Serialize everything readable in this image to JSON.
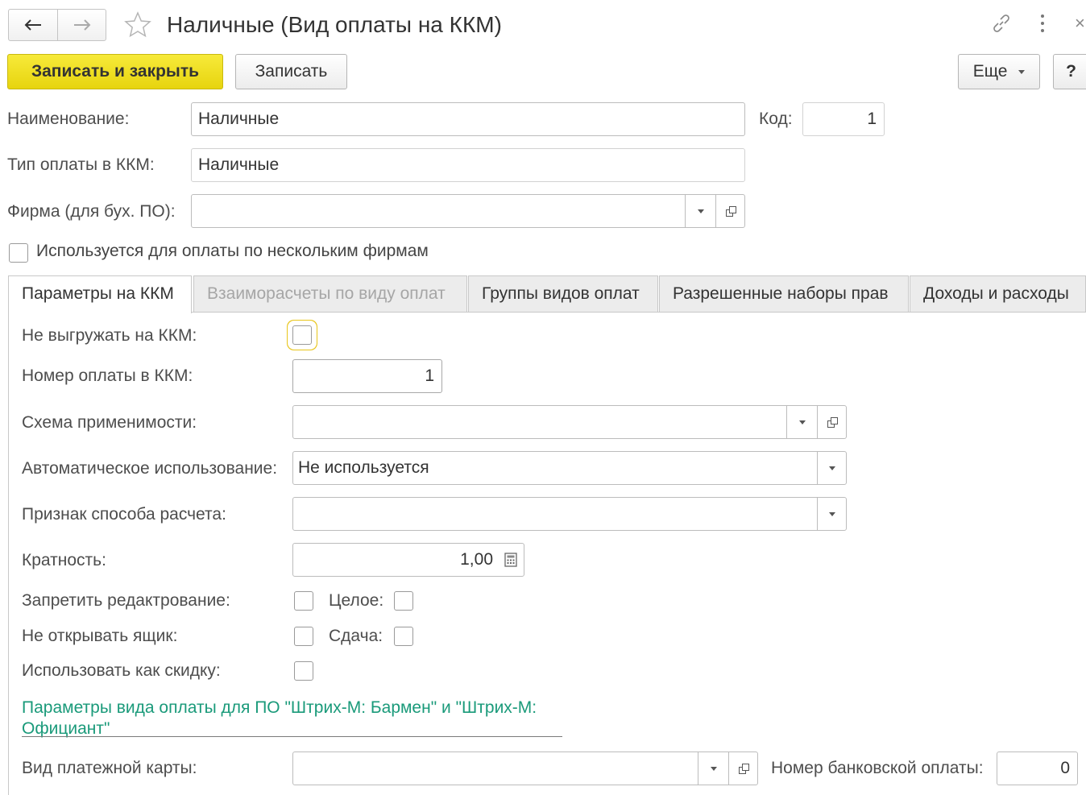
{
  "window": {
    "title": "Наличные (Вид оплаты на ККМ)"
  },
  "toolbar": {
    "save_close_label": "Записать и закрыть",
    "save_label": "Записать",
    "more_label": "Еще",
    "help_label": "?"
  },
  "header": {
    "name_label": "Наименование:",
    "name_value": "Наличные",
    "code_label": "Код:",
    "code_value": "1",
    "kkm_type_label": "Тип оплаты в ККМ:",
    "kkm_type_value": "Наличные",
    "firm_label": "Фирма (для бух. ПО):",
    "firm_value": "",
    "multi_firm_label": "Используется для оплаты по нескольким фирмам",
    "multi_firm_checked": false
  },
  "tabs": [
    {
      "label": "Параметры на ККМ",
      "active": true,
      "enabled": true
    },
    {
      "label": "Взаиморасчеты по виду оплат",
      "active": false,
      "enabled": false
    },
    {
      "label": "Группы видов оплат",
      "active": false,
      "enabled": true
    },
    {
      "label": "Разрешенные наборы прав",
      "active": false,
      "enabled": true
    },
    {
      "label": "Доходы и расходы",
      "active": false,
      "enabled": true
    }
  ],
  "params": {
    "no_export_label": "Не выгружать на ККМ:",
    "no_export_checked": false,
    "payment_number_label": "Номер оплаты в ККМ:",
    "payment_number_value": "1",
    "scheme_label": "Схема применимости:",
    "scheme_value": "",
    "auto_use_label": "Автоматическое использование:",
    "auto_use_value": "Не используется",
    "calc_method_label": "Признак способа расчета:",
    "calc_method_value": "",
    "multiplicity_label": "Кратность:",
    "multiplicity_value": "1,00",
    "forbid_edit_label": "Запретить редактрование:",
    "forbid_edit_checked": false,
    "integer_label": "Целое:",
    "integer_checked": false,
    "no_drawer_label": "Не открывать ящик:",
    "no_drawer_checked": false,
    "change_label": "Сдача:",
    "change_checked": false,
    "as_discount_label": "Использовать как скидку:",
    "as_discount_checked": false,
    "group_title": "Параметры вида оплаты для ПО \"Штрих-М: Бармен\" и \"Штрих-М: Официант\"",
    "card_type_label": "Вид платежной карты:",
    "card_type_value": "",
    "bank_payment_number_label": "Номер банковской оплаты:",
    "bank_payment_number_value": "0"
  },
  "colors": {
    "primary_button": "#f2e21b",
    "group_title": "#1a9a7a",
    "focus_border": "#e8c51a"
  }
}
